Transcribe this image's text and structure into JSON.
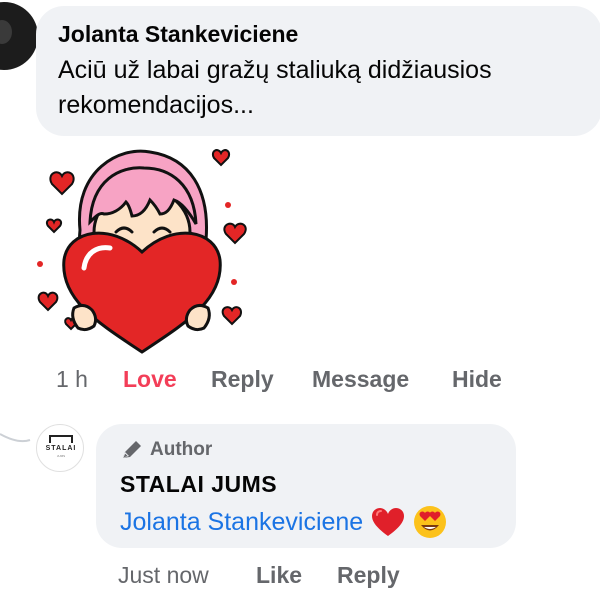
{
  "comment": {
    "author": "Jolanta Stankeviciene",
    "text": "Aciū  už labai gražų staliuką didžiausios rekomendacijos...",
    "time": "1 h",
    "reaction_label": "Love",
    "actions": [
      "Reply",
      "Message",
      "Hide"
    ]
  },
  "reply": {
    "badge_label": "Author",
    "page_name": "STALAI JUMS",
    "avatar_logo_text": "STALAI",
    "avatar_logo_sub": "JUMS",
    "mention": "Jolanta Stankeviciene",
    "emojis": [
      "red-heart",
      "heart-eyes-face"
    ],
    "time": "Just now",
    "actions": [
      "Like",
      "Reply"
    ]
  },
  "sticker": {
    "name": "girl-holding-heart-sticker"
  },
  "colors": {
    "bubble": "#f0f2f5",
    "secondary_text": "#65676b",
    "love": "#f33e58",
    "link": "#1b74e4",
    "heart": "#e32626",
    "hair": "#f7a3c4"
  }
}
